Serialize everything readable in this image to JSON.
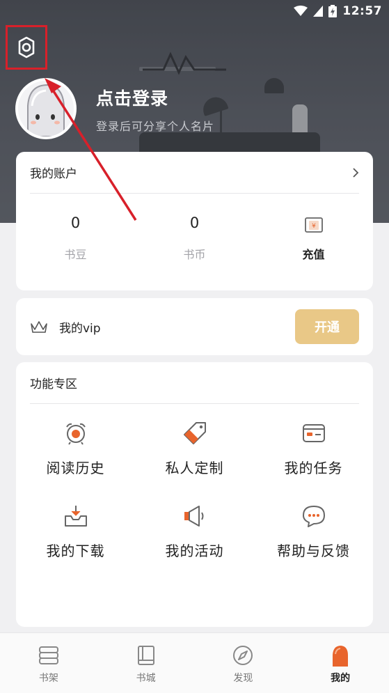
{
  "status_bar": {
    "time": "12:57"
  },
  "profile": {
    "login_title": "点击登录",
    "login_subtitle": "登录后可分享个人名片"
  },
  "account": {
    "title": "我的账户",
    "stats": [
      {
        "value": "0",
        "label": "书豆"
      },
      {
        "value": "0",
        "label": "书币"
      },
      {
        "value": "",
        "label": "充值",
        "icon": "recharge-icon"
      }
    ]
  },
  "vip": {
    "label": "我的vip",
    "button": "开通",
    "button_color": "#e9c887"
  },
  "features": {
    "title": "功能专区",
    "items": [
      {
        "label": "阅读历史",
        "icon": "alarm-clock-icon"
      },
      {
        "label": "私人定制",
        "icon": "tag-icon"
      },
      {
        "label": "我的任务",
        "icon": "wallet-icon"
      },
      {
        "label": "我的下载",
        "icon": "download-tray-icon"
      },
      {
        "label": "我的活动",
        "icon": "megaphone-icon"
      },
      {
        "label": "帮助与反馈",
        "icon": "chat-bubble-icon"
      }
    ]
  },
  "bottom_nav": {
    "items": [
      {
        "label": "书架",
        "icon": "bookshelf-icon"
      },
      {
        "label": "书城",
        "icon": "book-icon"
      },
      {
        "label": "发现",
        "icon": "compass-icon"
      },
      {
        "label": "我的",
        "icon": "ghost-icon",
        "active": true
      }
    ]
  },
  "colors": {
    "accent": "#e8642c",
    "highlight_box": "#d8202a",
    "vip_gold": "#e9c887"
  }
}
